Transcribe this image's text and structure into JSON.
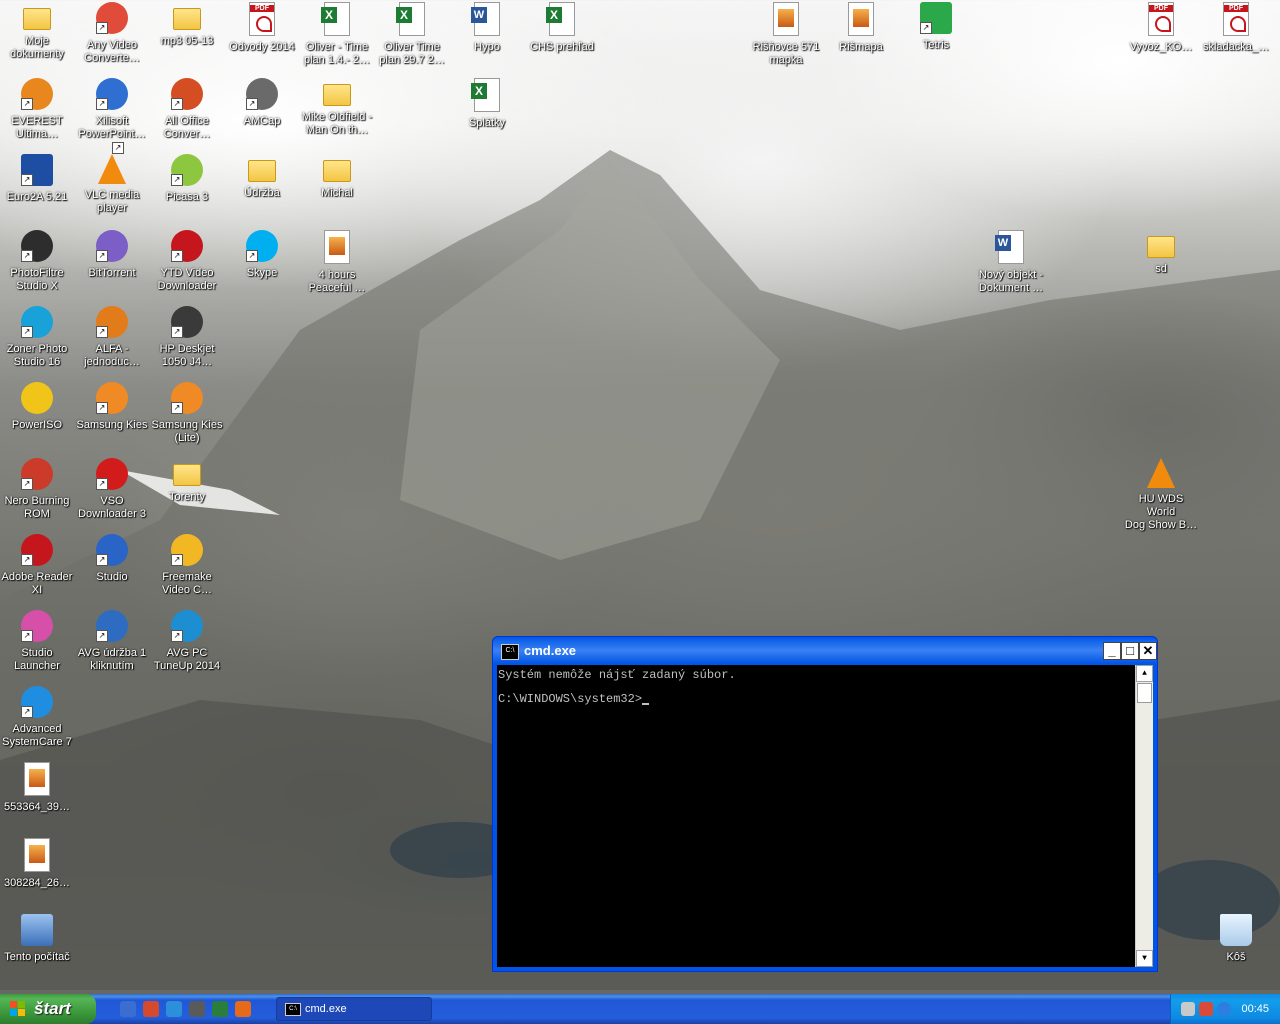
{
  "desktop": {
    "icons": [
      {
        "label": "Moje\ndokumenty",
        "glyph": "folder",
        "shortcut": false
      },
      {
        "label": "Any Video\nConverte…",
        "glyph": "circle",
        "color": "#e04b3a",
        "shortcut": true
      },
      {
        "label": "mp3 05-13",
        "glyph": "folder",
        "shortcut": false
      },
      {
        "label": "Odvody 2014",
        "glyph": "pdf",
        "shortcut": false
      },
      {
        "label": "Oliver - Time\nplan 1.4.- 2…",
        "glyph": "xls",
        "shortcut": false
      },
      {
        "label": "Oliver Time\nplan 29.7 2…",
        "glyph": "xls",
        "shortcut": false
      },
      {
        "label": "Hypo",
        "glyph": "doc",
        "shortcut": false
      },
      {
        "label": "CHS prehľad",
        "glyph": "xls",
        "shortcut": false
      },
      {
        "label": "Rišňovce 571\nmapka",
        "glyph": "img",
        "shortcut": false
      },
      {
        "label": "Rišmapa",
        "glyph": "img",
        "shortcut": false
      },
      {
        "label": "Tetris",
        "glyph": "tetris",
        "shortcut": true
      },
      {
        "label": "Vyvoz_KO…",
        "glyph": "pdf",
        "shortcut": false
      },
      {
        "label": "skladacka_…",
        "glyph": "pdf",
        "shortcut": false
      },
      {
        "label": "EVEREST\nUltima…",
        "glyph": "circle",
        "color": "#e8871e",
        "shortcut": true
      },
      {
        "label": "Xilisoft\nPowerPoint…",
        "glyph": "circle",
        "color": "#2e6fd1",
        "shortcut": true
      },
      {
        "label": "All Office\nConver…",
        "glyph": "circle",
        "color": "#d54d22",
        "shortcut": true
      },
      {
        "label": "AMCap",
        "glyph": "circle",
        "color": "#6a6a6a",
        "shortcut": true
      },
      {
        "label": "Mike Oldfield -\nMan On th…",
        "glyph": "folder",
        "shortcut": false
      },
      {
        "label": "Splátky",
        "glyph": "xls",
        "shortcut": false
      },
      {
        "label": "Euro2A 5.21",
        "glyph": "ecr",
        "shortcut": true
      },
      {
        "label": "VLC media\nplayer",
        "glyph": "vlc",
        "shortcut": true
      },
      {
        "label": "Picasa 3",
        "glyph": "circle",
        "color": "#8dc63f",
        "shortcut": true
      },
      {
        "label": "Údržba",
        "glyph": "folder",
        "shortcut": false
      },
      {
        "label": "Michal",
        "glyph": "folder",
        "shortcut": false
      },
      {
        "label": "PhotoFiltre\nStudio X",
        "glyph": "circle",
        "color": "#2d2d2d",
        "shortcut": true
      },
      {
        "label": "BitTorrent",
        "glyph": "circle",
        "color": "#7b5ec6",
        "shortcut": true
      },
      {
        "label": "YTD Video\nDownloader",
        "glyph": "circle",
        "color": "#c4161c",
        "shortcut": true
      },
      {
        "label": "Skype",
        "glyph": "skype",
        "shortcut": true
      },
      {
        "label": "4 hours\nPeaceful …",
        "glyph": "mp3",
        "shortcut": false
      },
      {
        "label": "Nový objekt -\nDokument …",
        "glyph": "doc",
        "shortcut": false
      },
      {
        "label": "sd",
        "glyph": "folder",
        "shortcut": false
      },
      {
        "label": "Zoner Photo\nStudio 16",
        "glyph": "circle",
        "color": "#19a2d9",
        "shortcut": true
      },
      {
        "label": "ALFA -\njednoduc…",
        "glyph": "circle",
        "color": "#e27c1b",
        "shortcut": true
      },
      {
        "label": "HP Deskjet\n1050 J4…",
        "glyph": "circle",
        "color": "#3a3a3a",
        "shortcut": true
      },
      {
        "label": "PowerISO",
        "glyph": "circle",
        "color": "#f0c419",
        "shortcut": false
      },
      {
        "label": "Samsung Kies",
        "glyph": "circle",
        "color": "#f08a24",
        "shortcut": true
      },
      {
        "label": "Samsung Kies\n(Lite)",
        "glyph": "circle",
        "color": "#f08a24",
        "shortcut": true
      },
      {
        "label": "Nero Burning\nROM",
        "glyph": "circle",
        "color": "#cc3b2a",
        "shortcut": true
      },
      {
        "label": "VSO\nDownloader 3",
        "glyph": "circle",
        "color": "#d21c1c",
        "shortcut": true
      },
      {
        "label": "Torenty",
        "glyph": "folder",
        "shortcut": false
      },
      {
        "label": "HU WDS World\nDog Show B…",
        "glyph": "vlc",
        "shortcut": false
      },
      {
        "label": "Adobe Reader\nXI",
        "glyph": "circle",
        "color": "#c4161c",
        "shortcut": true
      },
      {
        "label": "Studio",
        "glyph": "circle",
        "color": "#2a64c6",
        "shortcut": true
      },
      {
        "label": "Freemake\nVideo C…",
        "glyph": "circle",
        "color": "#f2b824",
        "shortcut": true
      },
      {
        "label": "Studio\nLauncher",
        "glyph": "circle",
        "color": "#d64fa8",
        "shortcut": true
      },
      {
        "label": "AVG údržba 1\nkliknutím",
        "glyph": "circle",
        "color": "#2d6cc0",
        "shortcut": true
      },
      {
        "label": "AVG PC\nTuneUp 2014",
        "glyph": "circle",
        "color": "#1c8ed1",
        "shortcut": true
      },
      {
        "label": "Advanced\nSystemCare 7",
        "glyph": "circle",
        "color": "#1f8de0",
        "shortcut": true
      },
      {
        "label": "553364_39…",
        "glyph": "img",
        "shortcut": false
      },
      {
        "label": "308284_26…",
        "glyph": "img",
        "shortcut": false
      },
      {
        "label": "Tento počítač",
        "glyph": "computer",
        "shortcut": false
      },
      {
        "label": "Kôš",
        "glyph": "recycle",
        "shortcut": false
      }
    ]
  },
  "window": {
    "title": "cmd.exe",
    "icon_text": "C:\\",
    "minimize": "_",
    "maximize": "□",
    "close": "✕",
    "lines": [
      "Systém nemôže nájsť zadaný súbor.",
      "",
      "C:\\WINDOWS\\system32>"
    ]
  },
  "taskbar": {
    "start_label": "štart",
    "task_label": "cmd.exe",
    "task_icon_text": "C:\\",
    "clock": "00:45",
    "quick_launch": [
      "show-desktop-icon",
      "media-icon",
      "tool-icon",
      "app-icon",
      "sheet-icon",
      "browser-firefox-icon"
    ],
    "tray_icons": [
      "network-icon",
      "security-icon",
      "ie-icon"
    ]
  },
  "colors": {
    "taskbar": "#245edb",
    "start": "#3c9a3c",
    "titlebar": "#0055e5",
    "console_bg": "#000000",
    "console_fg": "#c0c0c0"
  }
}
